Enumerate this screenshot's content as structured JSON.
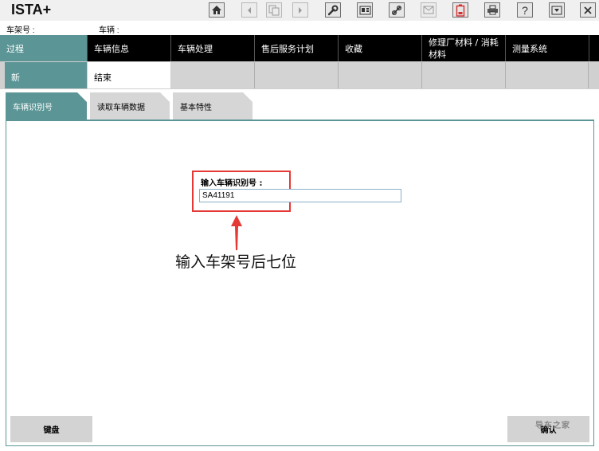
{
  "app": {
    "title": "ISTA+"
  },
  "toolbar": {
    "buttons": [
      {
        "name": "home-button",
        "icon": "home-icon",
        "enabled": true
      },
      {
        "name": "back-button",
        "icon": "arrow-left-icon",
        "enabled": false
      },
      {
        "name": "copy-button",
        "icon": "copy-pages-icon",
        "enabled": false
      },
      {
        "name": "forward-button",
        "icon": "arrow-right-icon",
        "enabled": false
      },
      {
        "name": "workshop-button",
        "icon": "wrench-icon",
        "enabled": true
      },
      {
        "name": "id-button",
        "icon": "id-card-icon",
        "enabled": true
      },
      {
        "name": "connection-button",
        "icon": "link-icon",
        "enabled": true
      },
      {
        "name": "messages-button",
        "icon": "envelope-icon",
        "enabled": false
      },
      {
        "name": "battery-button",
        "icon": "battery-icon",
        "enabled": true
      },
      {
        "name": "print-button",
        "icon": "printer-icon",
        "enabled": true
      },
      {
        "name": "help-button",
        "icon": "help-icon",
        "enabled": true
      },
      {
        "name": "minimize-button",
        "icon": "minimize-icon",
        "enabled": true
      },
      {
        "name": "close-button",
        "icon": "close-icon",
        "enabled": true
      }
    ]
  },
  "info": {
    "vin_label": "车架号 :",
    "vehicle_label": "车辆 :"
  },
  "nav": {
    "items": [
      {
        "label": "过程",
        "active": true
      },
      {
        "label": "车辆信息"
      },
      {
        "label": "车辆处理"
      },
      {
        "label": "售后服务计划"
      },
      {
        "label": "收藏"
      },
      {
        "label_line1": "修理厂材料 / 消耗",
        "label_line2": "材料"
      },
      {
        "label": "测量系统"
      }
    ]
  },
  "subnav": {
    "items": [
      {
        "label": "新",
        "active": true
      },
      {
        "label": "结束"
      }
    ]
  },
  "tabs": [
    {
      "label": "车辆识别号",
      "active": true
    },
    {
      "label": "读取车辆数据"
    },
    {
      "label": "基本特性"
    }
  ],
  "form": {
    "vin_label": "输入车辆识别号 :",
    "vin_value": "SA41191"
  },
  "annotation": {
    "text": "输入车架号后七位"
  },
  "buttons": {
    "keyboard": "键盘",
    "confirm": "确认"
  },
  "watermark": {
    "text": "导车之家"
  },
  "colors": {
    "accent": "#5b9595",
    "highlight": "#e53935",
    "nav_bg": "#000000",
    "arrow": "#e53935"
  }
}
